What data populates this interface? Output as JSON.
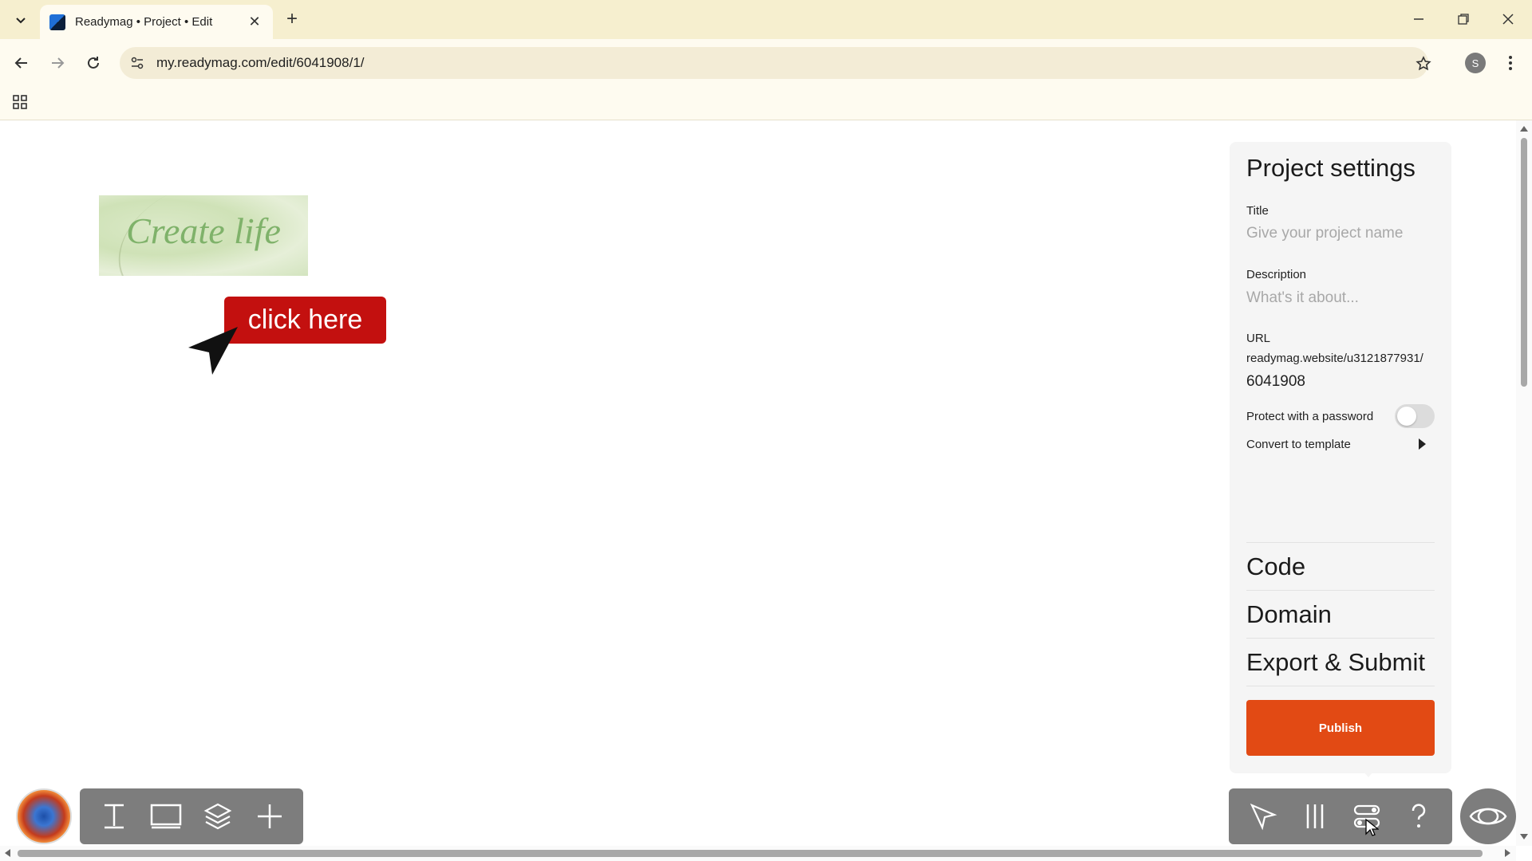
{
  "browser": {
    "tab_title": "Readymag • Project • Edit",
    "tab_close": "✕",
    "new_tab": "+",
    "url": "my.readymag.com/edit/6041908/1/",
    "profile_initial": "S"
  },
  "canvas": {
    "hero_text": "Create life",
    "cta_label": "click here"
  },
  "settings": {
    "title": "Project settings",
    "title_label": "Title",
    "title_placeholder": "Give your project name",
    "description_label": "Description",
    "description_placeholder": "What's it about...",
    "url_label": "URL",
    "url_line1": "readymag.website/u3121877931/",
    "url_line2": "6041908",
    "password_label": "Protect with a password",
    "password_enabled": false,
    "template_label": "Convert to template",
    "sections": [
      "Code",
      "Domain",
      "Export & Submit"
    ],
    "publish_label": "Publish"
  },
  "colors": {
    "publish": "#e24a14",
    "cta": "#c3100f",
    "toolbar_gray": "#7d7d7d",
    "chrome_bg": "#f6efcf"
  }
}
